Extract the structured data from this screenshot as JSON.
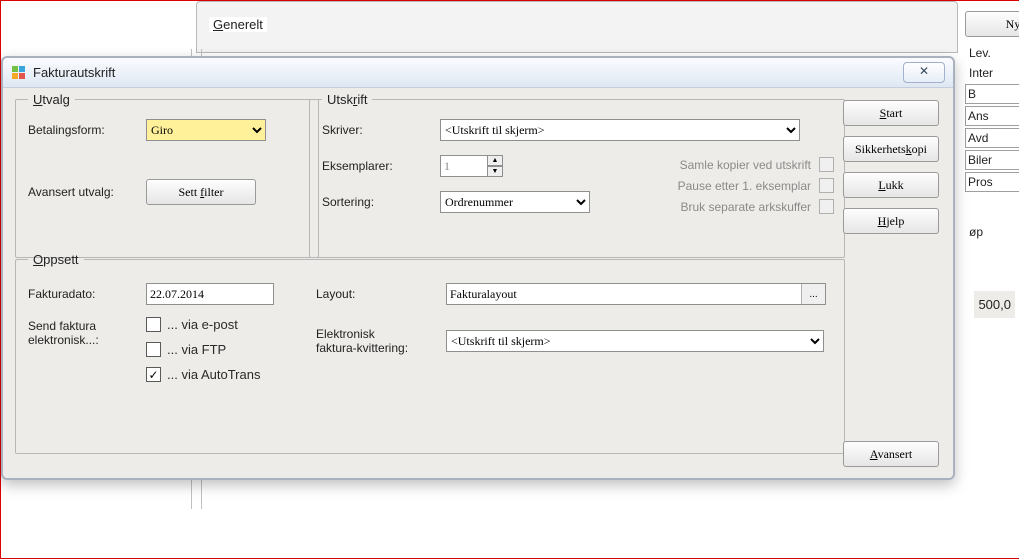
{
  "bg": {
    "generelt": "Generelt",
    "ny": "Ny",
    "right": [
      "Lev.",
      "Inter",
      "B",
      "Ans",
      "Avd",
      "Biler",
      "Pros",
      "øp",
      "500,0"
    ]
  },
  "window": {
    "title": "Fakturautskrift",
    "close": "✕"
  },
  "utvalg": {
    "legend": "Utvalg",
    "betalingsform_label": "Betalingsform:",
    "betalingsform_value": "Giro",
    "avansert_label": "Avansert utvalg:",
    "sett_filter": "Sett filter"
  },
  "utskrift": {
    "legend": "Utskrift",
    "skriver_label": "Skriver:",
    "skriver_value": "<Utskrift til skjerm>",
    "eksemplarer_label": "Eksemplarer:",
    "eksemplarer_value": "1",
    "sortering_label": "Sortering:",
    "sortering_value": "Ordrenummer",
    "opt_samle": "Samle kopier ved utskrift",
    "opt_pause": "Pause etter 1. eksemplar",
    "opt_ark": "Bruk separate arkskuffer"
  },
  "oppsett": {
    "legend": "Oppsett",
    "fakturadato_label": "Fakturadato:",
    "fakturadato_value": "22.07.2014",
    "send_label_1": "Send faktura",
    "send_label_2": "elektronisk...:",
    "via_epost": "... via e-post",
    "via_ftp": "... via FTP",
    "via_autotrans": "... via AutoTrans",
    "layout_label": "Layout:",
    "layout_value": "Fakturalayout",
    "elk_label_1": "Elektronisk",
    "elk_label_2": "faktura-kvittering:",
    "elk_value": "<Utskrift til skjerm>"
  },
  "buttons": {
    "start": "Start",
    "sikkerhet": "Sikkerhetskopi",
    "lukk": "Lukk",
    "hjelp": "Hjelp",
    "avansert": "Avansert"
  }
}
